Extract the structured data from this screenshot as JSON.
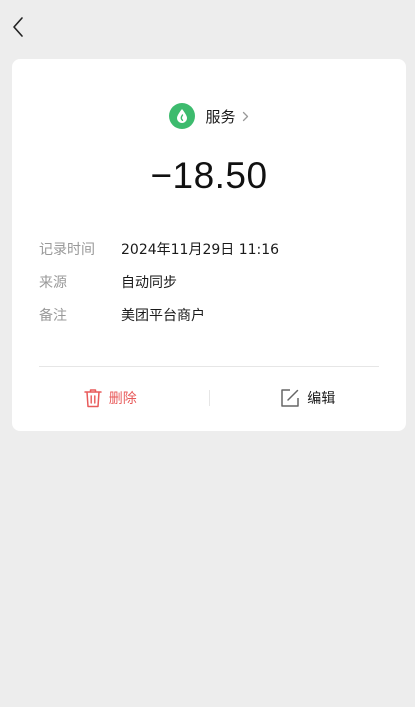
{
  "nav": {
    "back_icon": "chevron-left-icon"
  },
  "record": {
    "category": {
      "label": "服务",
      "icon": "water-drop-icon",
      "color": "#3dbb6e"
    },
    "amount": "−18.50",
    "details": [
      {
        "label": "记录时间",
        "value": "2024年11月29日 11:16"
      },
      {
        "label": "来源",
        "value": "自动同步"
      },
      {
        "label": "备注",
        "value": "美团平台商户"
      }
    ]
  },
  "actions": {
    "delete_label": "删除",
    "delete_icon": "trash-icon",
    "delete_color": "#e85a5a",
    "edit_label": "编辑",
    "edit_icon": "edit-icon"
  },
  "colors": {
    "background": "#ededed",
    "card": "#ffffff"
  }
}
